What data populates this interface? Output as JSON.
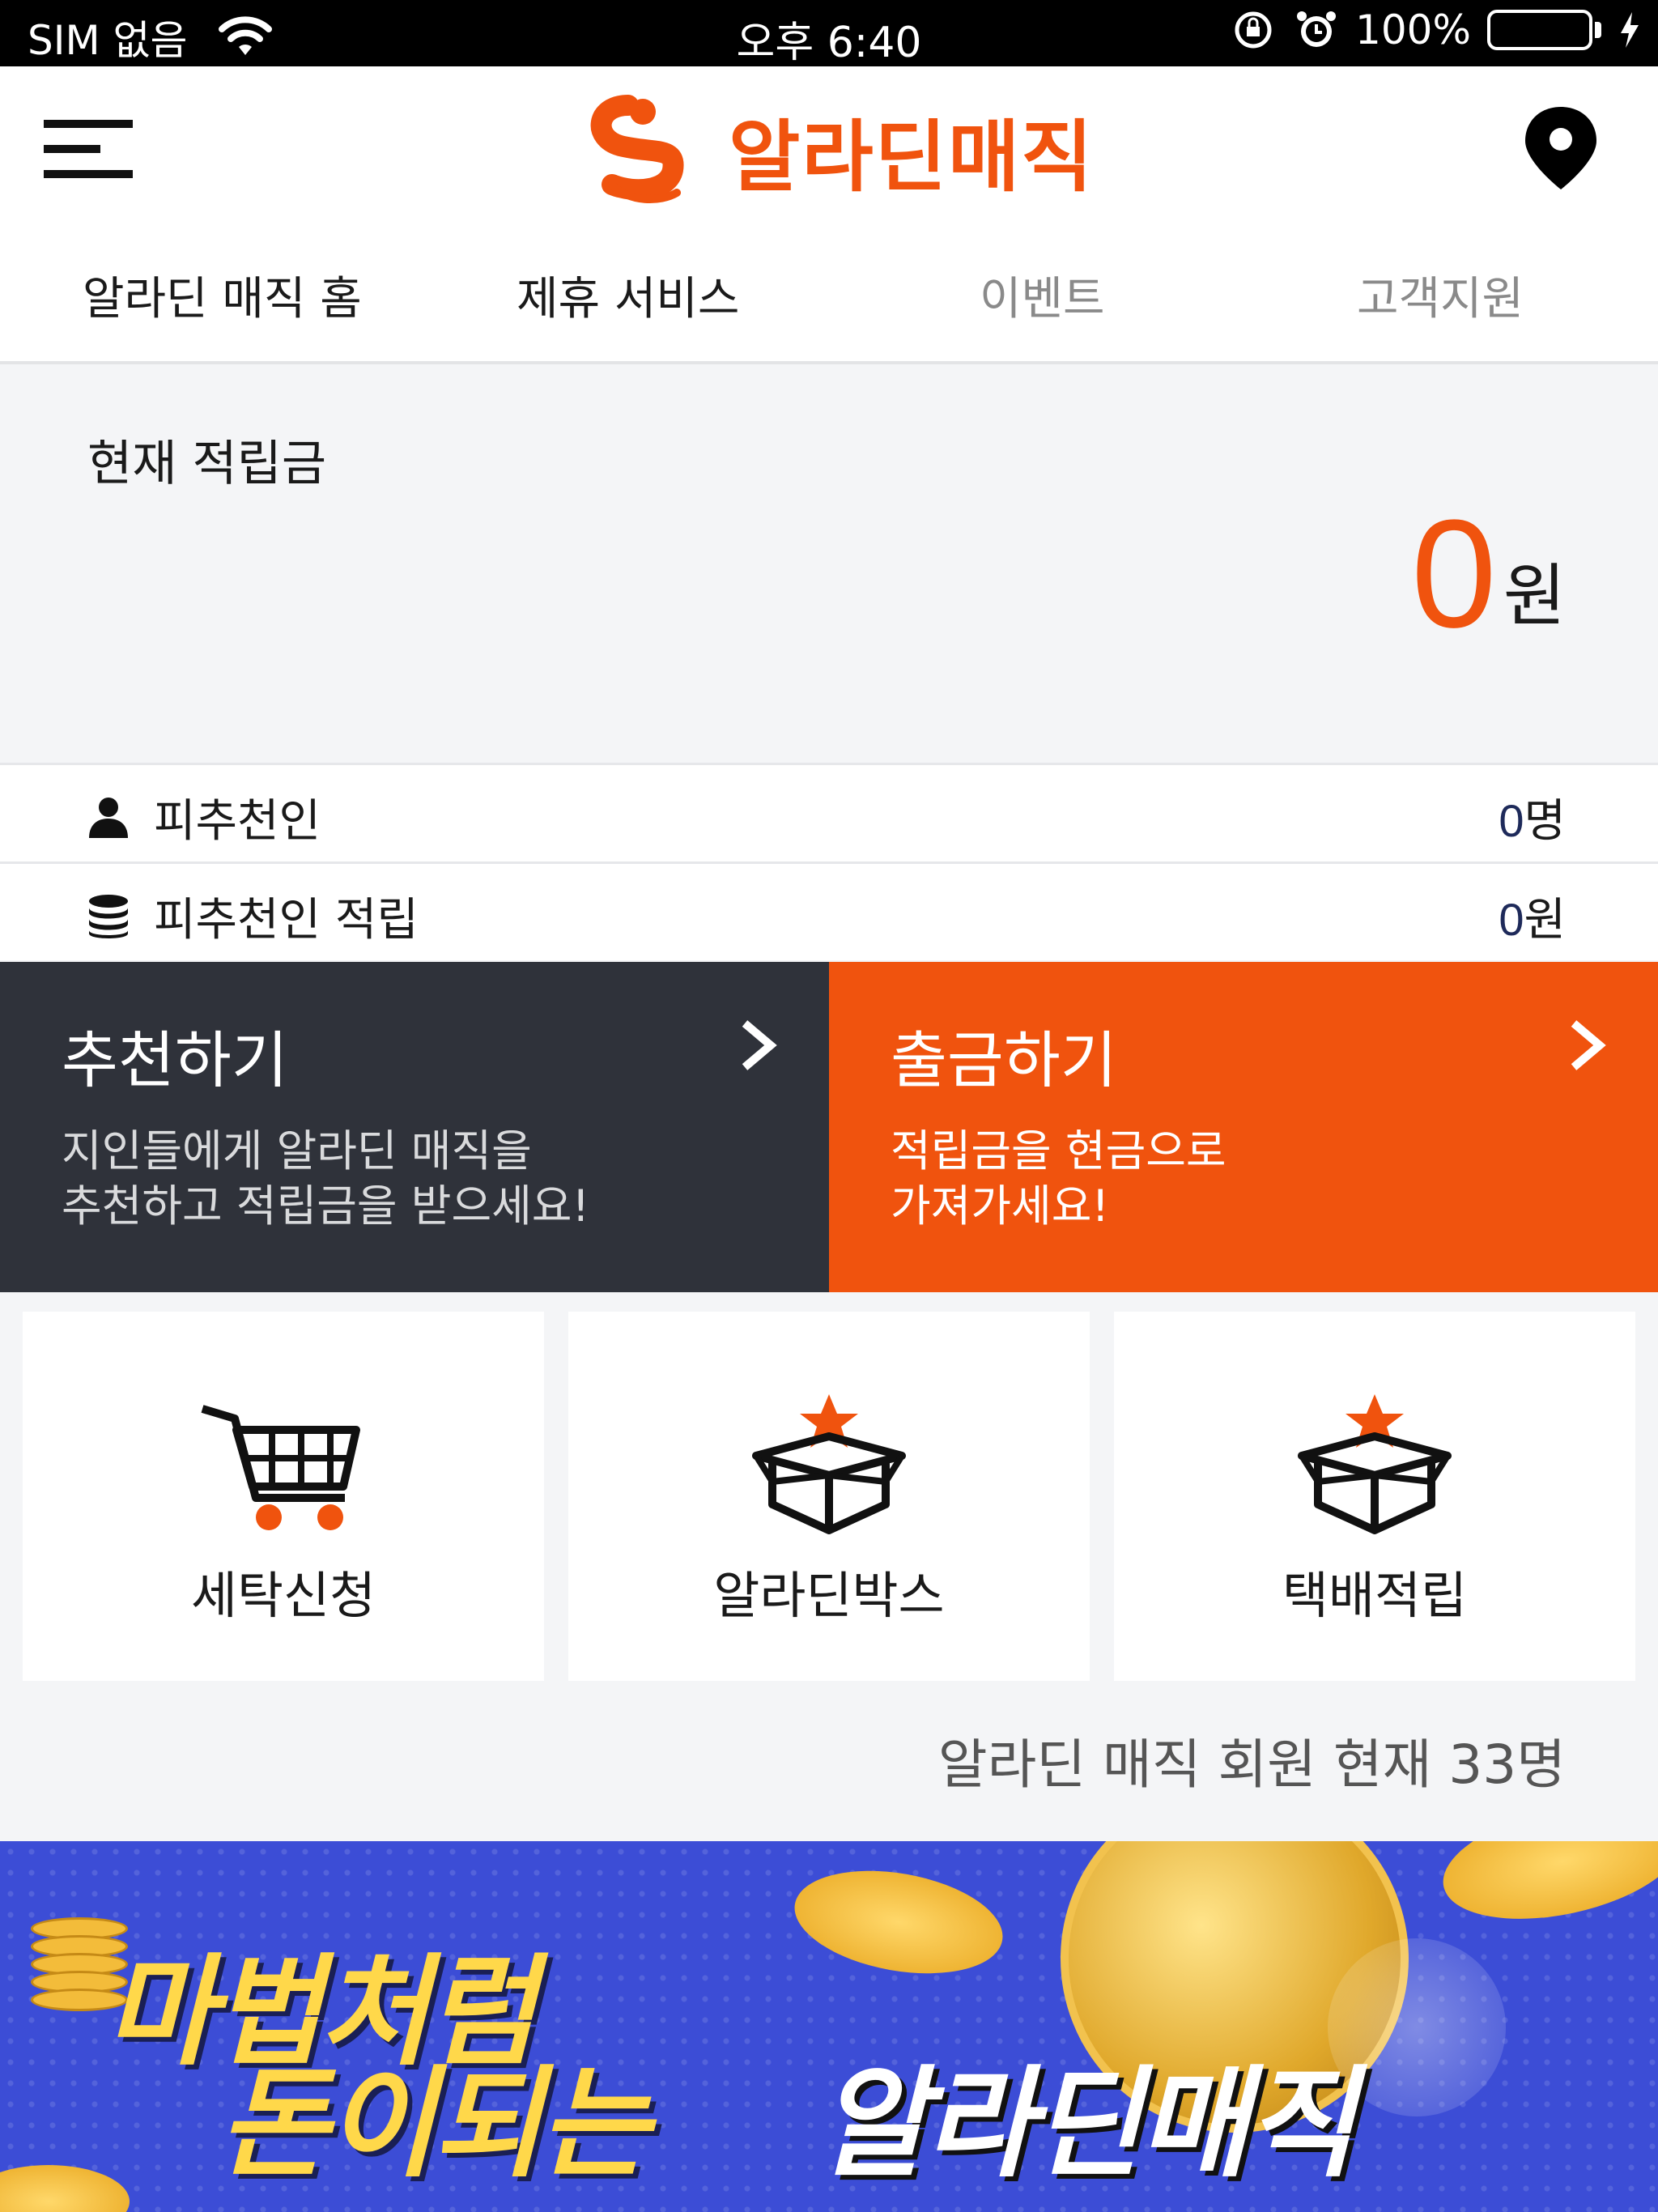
{
  "status_bar": {
    "carrier": "SIM 없음",
    "time": "오후 6:40",
    "battery": "100%",
    "battery_color": "#4cd964"
  },
  "header": {
    "app_name": "알라딘매직",
    "brand_color": "#f0530e",
    "menu_icon": "hamburger-icon",
    "location_icon": "map-pin-icon"
  },
  "tabs": [
    {
      "label": "알라딘 매직 홈",
      "active": true
    },
    {
      "label": "제휴 서비스",
      "active": true
    },
    {
      "label": "이벤트",
      "active": false
    },
    {
      "label": "고객지원",
      "active": false
    }
  ],
  "balance": {
    "label": "현재 적립금",
    "amount": "0",
    "unit": "원"
  },
  "stats": [
    {
      "icon": "person-icon",
      "label": "피추천인",
      "value": "0",
      "unit": "명"
    },
    {
      "icon": "coins-stack-icon",
      "label": "피추천인 적립",
      "value": "0",
      "unit": "원"
    }
  ],
  "actions": [
    {
      "title": "추천하기",
      "desc_line1": "지인들에게 알라딘 매직을",
      "desc_line2": "추천하고 적립금을 받으세요!",
      "color": "#2f323a"
    },
    {
      "title": "출금하기",
      "desc_line1": "적립금을 현금으로",
      "desc_line2": "가져가세요!",
      "color": "#f0530e"
    }
  ],
  "tiles": [
    {
      "icon": "shopping-cart-icon",
      "label": "세탁신청"
    },
    {
      "icon": "star-box-icon",
      "label": "알라딘박스"
    },
    {
      "icon": "star-box-icon",
      "label": "택배적립"
    }
  ],
  "members_text": "알라딘 매직 회원 현재 33명",
  "banner": {
    "line1": "마법처럼",
    "line2": "돈이되는",
    "line3": "알라딘매직"
  }
}
